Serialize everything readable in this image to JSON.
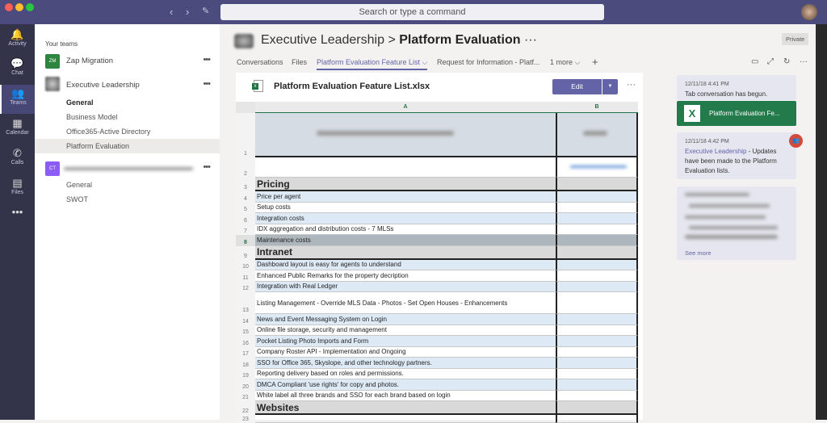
{
  "window": {
    "search_placeholder": "Search or type a command",
    "colors": {
      "titlebar": "#4b4c7d",
      "rail": "#33344a",
      "accent": "#6264a7",
      "excel": "#217346"
    }
  },
  "rail": [
    {
      "label": "Activity",
      "icon": "bell-icon",
      "glyph": "🔔"
    },
    {
      "label": "Chat",
      "icon": "chat-icon",
      "glyph": "💬"
    },
    {
      "label": "Teams",
      "icon": "teams-icon",
      "glyph": "👥"
    },
    {
      "label": "Calendar",
      "icon": "calendar-icon",
      "glyph": "▦"
    },
    {
      "label": "Calls",
      "icon": "phone-icon",
      "glyph": "✆"
    },
    {
      "label": "Files",
      "icon": "file-icon",
      "glyph": "▤"
    },
    {
      "label": "",
      "icon": "more-icon",
      "glyph": "•••"
    }
  ],
  "teams": {
    "label": "Your teams",
    "zap": {
      "initials": "ZM",
      "name": "Zap Migration"
    },
    "exec": {
      "name": "Executive Leadership",
      "channels": [
        "General",
        "Business Model",
        "Office365-Active Directory",
        "Platform Evaluation"
      ]
    },
    "ct": {
      "initials": "CT",
      "channels": [
        "General",
        "SWOT"
      ]
    }
  },
  "header": {
    "team": "Executive Leadership",
    "separator": ">",
    "channel": "Platform Evaluation",
    "more": "···",
    "private": "Private"
  },
  "tabs": [
    {
      "label": "Conversations"
    },
    {
      "label": "Files"
    },
    {
      "label": "Platform Evaluation Feature List ⌵"
    },
    {
      "label": "Request for Information - Platf..."
    },
    {
      "label": "1 more ⌵"
    },
    {
      "label": "+"
    }
  ],
  "doc": {
    "title": "Platform Evaluation Feature List.xlsx",
    "edit": "Edit",
    "more": "···",
    "columns": [
      "A",
      "B"
    ],
    "rows": [
      {
        "n": "1",
        "text": "",
        "type": "title"
      },
      {
        "n": "2",
        "text": "",
        "type": "plain"
      },
      {
        "n": "3",
        "text": "Pricing",
        "type": "sec"
      },
      {
        "n": "4",
        "text": "Price per agent",
        "type": "blue"
      },
      {
        "n": "5",
        "text": "Setup costs",
        "type": "plain"
      },
      {
        "n": "6",
        "text": "Integration costs",
        "type": "blue"
      },
      {
        "n": "7",
        "text": "IDX aggregation and distribution costs - 7 MLSs",
        "type": "plain"
      },
      {
        "n": "8",
        "text": "Maintenance costs",
        "type": "sel"
      },
      {
        "n": "9",
        "text": "Intranet",
        "type": "sec"
      },
      {
        "n": "10",
        "text": "Dashboard layout is easy for agents to understand",
        "type": "blue"
      },
      {
        "n": "11",
        "text": "Enhanced Public Remarks for the property decription",
        "type": "plain"
      },
      {
        "n": "12",
        "text": "Integration with Real Ledger",
        "type": "blue"
      },
      {
        "n": "13",
        "text": "Listing Management - Override MLS Data - Photos - Set Open Houses - Enhancements",
        "type": "plain"
      },
      {
        "n": "14",
        "text": "News and Event Messaging System on Login",
        "type": "blue"
      },
      {
        "n": "15",
        "text": "Online file storage, security and management",
        "type": "plain"
      },
      {
        "n": "16",
        "text": "Pocket Listing Photo Imports and Form",
        "type": "blue"
      },
      {
        "n": "17",
        "text": "Company Roster API - Implementation and Ongoing",
        "type": "plain"
      },
      {
        "n": "18",
        "text": "SSO for Office 365, Skyslope, and other technology partners.",
        "type": "blue"
      },
      {
        "n": "19",
        "text": "Reporting delivery based on roles and permissions.",
        "type": "plain"
      },
      {
        "n": "20",
        "text": "DMCA Compliant 'use rights' for copy and photos.",
        "type": "blue"
      },
      {
        "n": "21",
        "text": "White label all three brands and SSO for each brand based on login",
        "type": "plain"
      },
      {
        "n": "22",
        "text": "Websites",
        "type": "sec"
      },
      {
        "n": "23",
        "text": "",
        "type": "plain"
      }
    ]
  },
  "conversation": {
    "m1": {
      "time": "12/11/18 4:41 PM",
      "text": "Tab conversation has begun.",
      "file": "Platform Evaluation Fe..."
    },
    "m2": {
      "time": "12/11/18 4:42 PM",
      "team": "Executive Leadership",
      "text": " - Updates have been made to the Platform Evaluation lists."
    },
    "m3": {
      "see_more": "See more"
    }
  }
}
